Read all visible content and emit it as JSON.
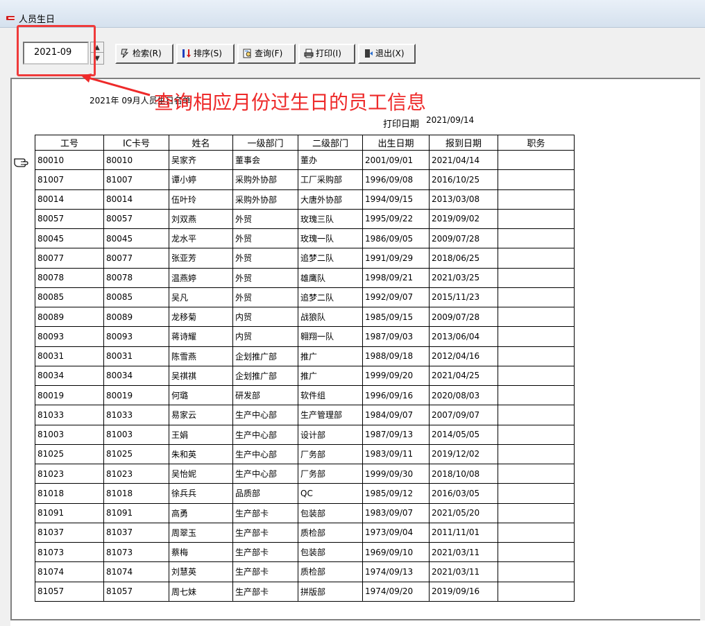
{
  "window": {
    "title": "人员生日"
  },
  "toolbar": {
    "month_value": "2021-09",
    "buttons": [
      {
        "label": "检索(R)",
        "icon": "search-lightning-icon"
      },
      {
        "label": "排序(S)",
        "icon": "sort-icon"
      },
      {
        "label": "查询(F)",
        "icon": "query-icon"
      },
      {
        "label": "打印(I)",
        "icon": "printer-icon"
      },
      {
        "label": "退出(X)",
        "icon": "exit-icon"
      }
    ]
  },
  "annotation": {
    "text": "查询相应月份过生日的员工信息",
    "color": "#ee2a2a"
  },
  "report": {
    "title": "2021年 09月人员生日名单",
    "print_date_label": "打印日期",
    "print_date": "2021/09/14",
    "columns": [
      "工号",
      "IC卡号",
      "姓名",
      "一级部门",
      "二级部门",
      "出生日期",
      "报到日期",
      "职务"
    ],
    "rows": [
      [
        "80010",
        "80010",
        "吴家齐",
        "董事会",
        "董办",
        "2001/09/01",
        "2021/04/14",
        ""
      ],
      [
        "81007",
        "81007",
        "谭小婷",
        "采购外协部",
        "工厂采购部",
        "1996/09/08",
        "2016/10/25",
        ""
      ],
      [
        "80014",
        "80014",
        "伍叶玲",
        "采购外协部",
        "大唐外协部",
        "1994/09/15",
        "2013/03/08",
        ""
      ],
      [
        "80057",
        "80057",
        "刘双燕",
        "外贸",
        "玫瑰三队",
        "1995/09/22",
        "2019/09/02",
        ""
      ],
      [
        "80045",
        "80045",
        "龙水平",
        "外贸",
        "玫瑰一队",
        "1986/09/05",
        "2009/07/28",
        ""
      ],
      [
        "80077",
        "80077",
        "张亚芳",
        "外贸",
        "追梦二队",
        "1991/09/29",
        "2018/06/25",
        ""
      ],
      [
        "80078",
        "80078",
        "温燕婷",
        "外贸",
        "雄鹰队",
        "1998/09/21",
        "2021/03/25",
        ""
      ],
      [
        "80085",
        "80085",
        "吴凡",
        "外贸",
        "追梦二队",
        "1992/09/07",
        "2015/11/23",
        ""
      ],
      [
        "80089",
        "80089",
        "龙移菊",
        "内贸",
        "战狼队",
        "1985/09/15",
        "2009/07/28",
        ""
      ],
      [
        "80093",
        "80093",
        "蒋诗耀",
        "内贸",
        "翱翔一队",
        "1987/09/03",
        "2013/06/04",
        ""
      ],
      [
        "80031",
        "80031",
        "陈雪燕",
        "企划推广部",
        "推广",
        "1988/09/18",
        "2012/04/16",
        ""
      ],
      [
        "80034",
        "80034",
        "吴祺祺",
        "企划推广部",
        "推广",
        "1999/09/20",
        "2021/04/25",
        ""
      ],
      [
        "80019",
        "80019",
        "何璐",
        "研发部",
        "软件组",
        "1996/09/16",
        "2020/08/03",
        ""
      ],
      [
        "81033",
        "81033",
        "易家云",
        "生产中心部",
        "生产管理部",
        "1984/09/07",
        "2007/09/07",
        ""
      ],
      [
        "81003",
        "81003",
        "王娟",
        "生产中心部",
        "设计部",
        "1987/09/13",
        "2014/05/05",
        ""
      ],
      [
        "81025",
        "81025",
        "朱和英",
        "生产中心部",
        "厂务部",
        "1983/09/11",
        "2019/12/02",
        ""
      ],
      [
        "81023",
        "81023",
        "吴怡妮",
        "生产中心部",
        "厂务部",
        "1999/09/30",
        "2018/10/08",
        ""
      ],
      [
        "81018",
        "81018",
        "徐兵兵",
        "品质部",
        "QC",
        "1985/09/12",
        "2016/03/05",
        ""
      ],
      [
        "81091",
        "81091",
        "高勇",
        "生产部卡",
        "包装部",
        "1983/09/07",
        "2021/05/20",
        ""
      ],
      [
        "81037",
        "81037",
        "周翠玉",
        "生产部卡",
        "质检部",
        "1973/09/04",
        "2011/11/01",
        ""
      ],
      [
        "81073",
        "81073",
        "蔡梅",
        "生产部卡",
        "包装部",
        "1969/09/10",
        "2021/03/11",
        ""
      ],
      [
        "81074",
        "81074",
        "刘慧英",
        "生产部卡",
        "质检部",
        "1974/09/13",
        "2021/03/11",
        ""
      ],
      [
        "81057",
        "81057",
        "周七妹",
        "生产部卡",
        "拼版部",
        "1974/09/20",
        "2019/09/16",
        ""
      ]
    ]
  }
}
